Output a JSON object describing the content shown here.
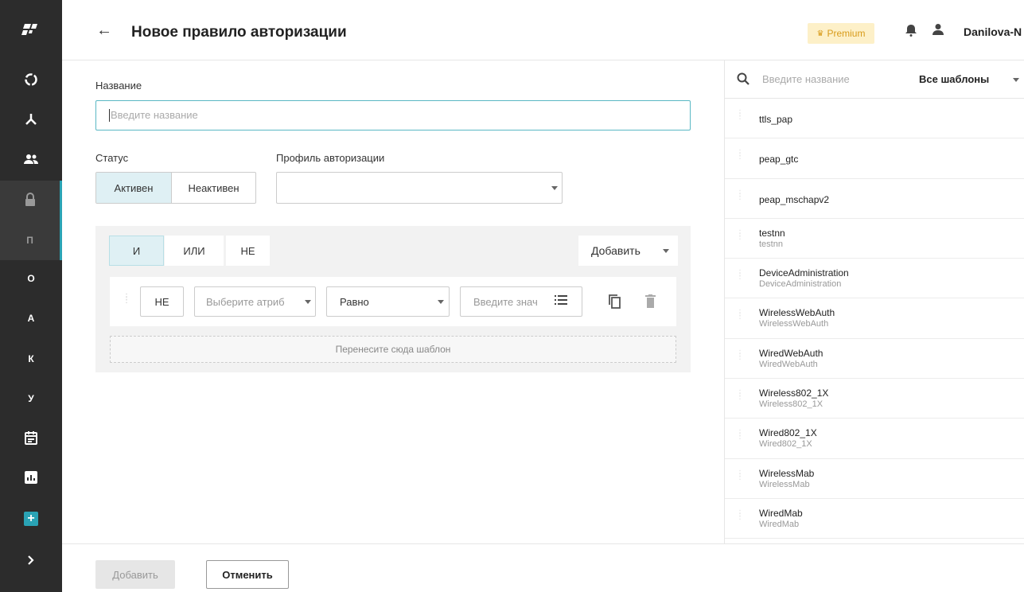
{
  "header": {
    "title": "Новое правило авторизации",
    "premium": "Premium",
    "username": "Danilova-N"
  },
  "sidebar": {
    "items": [
      {
        "icon": "logo-icon"
      },
      {
        "icon": "circle-progress-icon"
      },
      {
        "icon": "network-icon"
      },
      {
        "icon": "users-icon"
      },
      {
        "icon": "lock-icon"
      },
      {
        "label": "П"
      },
      {
        "label": "О"
      },
      {
        "label": "А"
      },
      {
        "label": "К"
      },
      {
        "label": "У"
      },
      {
        "icon": "calendar-icon"
      },
      {
        "icon": "chart-icon"
      },
      {
        "icon": "plus-icon"
      },
      {
        "icon": "chevron-right-icon"
      }
    ]
  },
  "form": {
    "name_label": "Название",
    "name_placeholder": "Введите название",
    "status_label": "Статус",
    "status_active": "Активен",
    "status_inactive": "Неактивен",
    "profile_label": "Профиль авторизации",
    "profile_value": ""
  },
  "conditions": {
    "and": "И",
    "or": "ИЛИ",
    "not": "НЕ",
    "add": "Добавить",
    "row": {
      "not": "НЕ",
      "attribute_placeholder": "Выберите атриб",
      "operator": "Равно",
      "value_placeholder": "Введите знач"
    },
    "drop_hint": "Перенесите сюда шаблон"
  },
  "footer": {
    "add": "Добавить",
    "cancel": "Отменить"
  },
  "templates_panel": {
    "search_placeholder": "Введите название",
    "filter": "Все шаблоны",
    "items": [
      {
        "name": "ttls_pap",
        "sub": ""
      },
      {
        "name": "peap_gtc",
        "sub": ""
      },
      {
        "name": "peap_mschapv2",
        "sub": ""
      },
      {
        "name": "testnn",
        "sub": "testnn"
      },
      {
        "name": "DeviceAdministration",
        "sub": "DeviceAdministration"
      },
      {
        "name": "WirelessWebAuth",
        "sub": "WirelessWebAuth"
      },
      {
        "name": "WiredWebAuth",
        "sub": "WiredWebAuth"
      },
      {
        "name": "Wireless802_1X",
        "sub": "Wireless802_1X"
      },
      {
        "name": "Wired802_1X",
        "sub": "Wired802_1X"
      },
      {
        "name": "WirelessMab",
        "sub": "WirelessMab"
      },
      {
        "name": "WiredMab",
        "sub": "WiredMab"
      }
    ]
  }
}
